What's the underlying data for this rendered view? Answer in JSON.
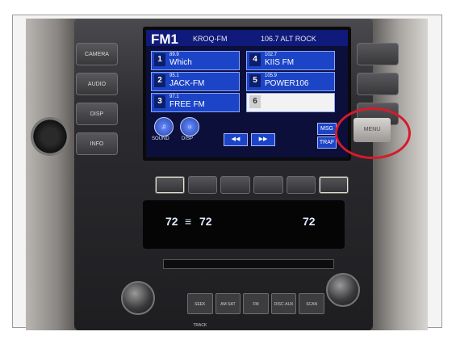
{
  "radio": {
    "band": "FM1",
    "station_call": "KROQ-FM",
    "station_info": "106.7 ALT ROCK",
    "presets": [
      {
        "num": "1",
        "freq": "89.9",
        "name": "Which"
      },
      {
        "num": "2",
        "freq": "95.1",
        "name": "JACK-FM"
      },
      {
        "num": "3",
        "freq": "97.1",
        "name": "FREE FM"
      },
      {
        "num": "4",
        "freq": "102.7",
        "name": "KIIS FM"
      },
      {
        "num": "5",
        "freq": "105.9",
        "name": "POWER106"
      },
      {
        "num": "6",
        "freq": "",
        "name": ""
      }
    ],
    "round_buttons": {
      "sound": "SOUND",
      "disp": "DISP"
    },
    "right_buttons": {
      "msg": "MSG",
      "traf": "TRAF"
    }
  },
  "side_buttons": {
    "left": [
      "CAMERA",
      "AUDIO",
      "DISP",
      "INFO"
    ],
    "right": [
      "",
      "",
      "",
      "MENU"
    ]
  },
  "climate": {
    "driver_temp": "72",
    "driver_temp_set": "72",
    "passenger_temp": "72"
  },
  "menu_button_label": "MENU",
  "bottom_buttons": [
    "SEEK TRACK",
    "AM·SAT",
    "FM",
    "DISC·AUX",
    "SCAN"
  ],
  "highlight_color": "#d61a2b"
}
